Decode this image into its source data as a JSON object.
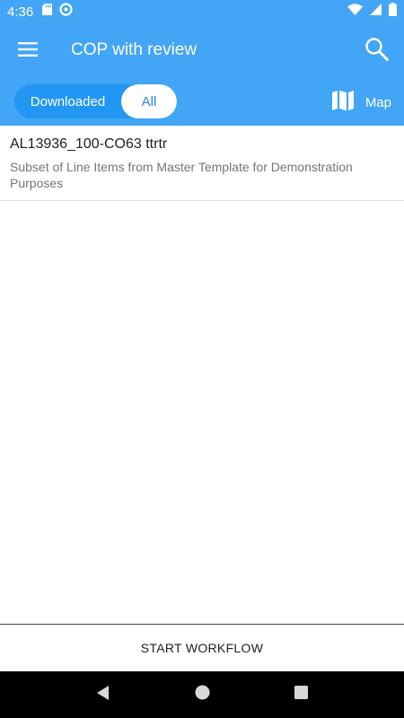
{
  "status_bar": {
    "time": "4:36",
    "left_icons": [
      "sd-card-icon",
      "data-saver-icon"
    ],
    "right_icons": [
      "wifi-icon",
      "cell-signal-icon",
      "battery-icon"
    ]
  },
  "app_bar": {
    "title": "COP with review",
    "menu_icon": "hamburger-menu-icon",
    "search_icon": "search-icon",
    "color": "#42a5f5"
  },
  "filter": {
    "options": [
      "Downloaded",
      "All"
    ],
    "selected": "All"
  },
  "map_button": {
    "label": "Map",
    "icon": "map-icon"
  },
  "list": {
    "items": [
      {
        "title": "AL13936_100-CO63 ttrtr",
        "subtitle": "Subset of Line Items from Master Template for Demonstration Purposes"
      }
    ]
  },
  "bottom_action": {
    "label": "START WORKFLOW"
  },
  "nav_bar": {
    "buttons": [
      "back-icon",
      "home-icon",
      "recents-icon"
    ]
  }
}
